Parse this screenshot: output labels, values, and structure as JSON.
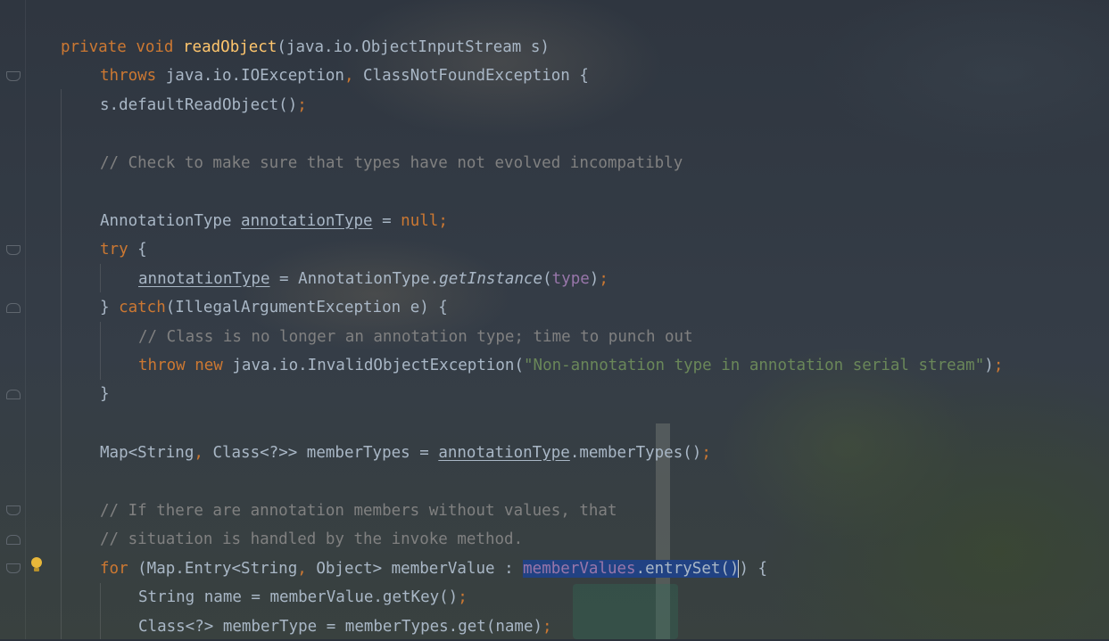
{
  "editor": {
    "lines": [
      {
        "tokens": [
          {
            "t": "private",
            "c": "kw"
          },
          {
            "t": " "
          },
          {
            "t": "void",
            "c": "kw"
          },
          {
            "t": " "
          },
          {
            "t": "readObject",
            "c": "fn"
          },
          {
            "t": "(java.io.ObjectInputStream s)"
          }
        ]
      },
      {
        "tokens": [
          {
            "t": "throws",
            "c": "kw"
          },
          {
            "t": " java.io.IOException"
          },
          {
            "t": ",",
            "c": "kw"
          },
          {
            "t": " ClassNotFoundException {"
          }
        ]
      },
      {
        "tokens": [
          {
            "t": "s.defaultReadObject()"
          },
          {
            "t": ";",
            "c": "kw"
          }
        ]
      },
      {
        "tokens": [
          {
            "t": "// Check to make sure that types have not evolved incompatibly",
            "c": "cm"
          }
        ]
      },
      {
        "tokens": [
          {
            "t": "AnnotationType "
          },
          {
            "t": "annotationType",
            "c": "ul"
          },
          {
            "t": " = "
          },
          {
            "t": "null",
            "c": "kw"
          },
          {
            "t": ";",
            "c": "kw"
          }
        ]
      },
      {
        "tokens": [
          {
            "t": "try",
            "c": "kw"
          },
          {
            "t": " {"
          }
        ]
      },
      {
        "tokens": [
          {
            "t": "annotationType",
            "c": "ul"
          },
          {
            "t": " = AnnotationType."
          },
          {
            "t": "getInstance",
            "c": "it"
          },
          {
            "t": "("
          },
          {
            "t": "type",
            "c": "field"
          },
          {
            "t": ")"
          },
          {
            "t": ";",
            "c": "kw"
          }
        ]
      },
      {
        "tokens": [
          {
            "t": "} "
          },
          {
            "t": "catch",
            "c": "kw"
          },
          {
            "t": "(IllegalArgumentException e) {"
          }
        ]
      },
      {
        "tokens": [
          {
            "t": "// Class is no longer an annotation type; time to punch out",
            "c": "cm"
          }
        ]
      },
      {
        "tokens": [
          {
            "t": "throw",
            "c": "kw"
          },
          {
            "t": " "
          },
          {
            "t": "new",
            "c": "kw"
          },
          {
            "t": " java.io.InvalidObjectException("
          },
          {
            "t": "\"Non-annotation type in annotation serial stream\"",
            "c": "str"
          },
          {
            "t": ")"
          },
          {
            "t": ";",
            "c": "kw"
          }
        ]
      },
      {
        "tokens": [
          {
            "t": "}"
          }
        ]
      },
      {
        "tokens": [
          {
            "t": "Map<String"
          },
          {
            "t": ",",
            "c": "kw"
          },
          {
            "t": " Class<?>> memberTypes = "
          },
          {
            "t": "annotationType",
            "c": "ul"
          },
          {
            "t": ".memberTypes()"
          },
          {
            "t": ";",
            "c": "kw"
          }
        ]
      },
      {
        "tokens": [
          {
            "t": "// If there are annotation members without values, that",
            "c": "cm"
          }
        ]
      },
      {
        "tokens": [
          {
            "t": "// situation is handled by the invoke method.",
            "c": "cm"
          }
        ]
      },
      {
        "tokens": [
          {
            "t": "for",
            "c": "kw"
          },
          {
            "t": " (Map.Entry<String"
          },
          {
            "t": ",",
            "c": "kw"
          },
          {
            "t": " Object> memberValue : "
          },
          {
            "t": "memberValues",
            "c": "field sel"
          },
          {
            "t": ".entrySet()",
            "c": "sel"
          },
          {
            "t": "",
            "c": "caret"
          },
          {
            "t": ") {"
          }
        ]
      },
      {
        "tokens": [
          {
            "t": "String name = memberValue.getKey()"
          },
          {
            "t": ";",
            "c": "kw"
          }
        ]
      },
      {
        "tokens": [
          {
            "t": "Class<?> memberType = memberTypes.get(name)"
          },
          {
            "t": ";",
            "c": "kw"
          }
        ]
      }
    ]
  }
}
